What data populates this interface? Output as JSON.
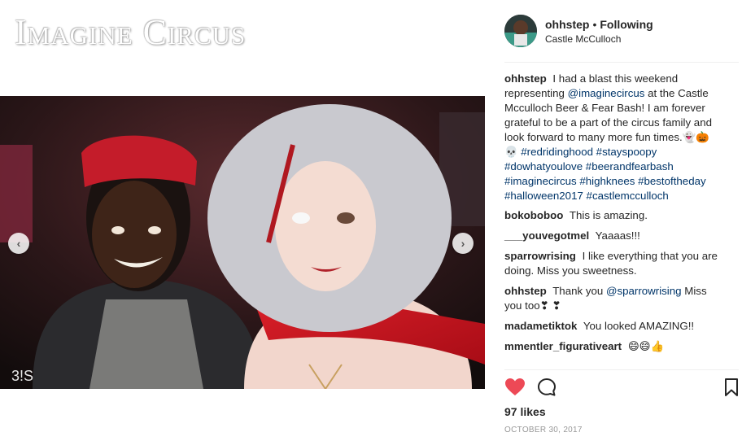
{
  "logo": {
    "text": "Imagine Circus"
  },
  "photo": {
    "watermark": "3ǃS",
    "prev_glyph": "‹",
    "next_glyph": "›"
  },
  "post": {
    "username": "ohhstep",
    "separator": "•",
    "follow_label": "Following",
    "location": "Castle McCulloch",
    "caption": {
      "user": "ohhstep",
      "text_before": "I had a blast this weekend representing",
      "mention": "@imaginecircus",
      "text_after": "at the Castle Mcculloch Beer & Fear Bash! I am forever grateful to be a part of the circus family and look forward to many more fun times.",
      "emoji": "👻🎃💀",
      "hashtags": "#redridinghood #stayspoopy #dowhatyoulove #beerandfearbash #imaginecircus #highknees #bestoftheday #halloween2017 #castlemcculloch"
    },
    "comments": [
      {
        "user": "bokoboboo",
        "text": "This is amazing."
      },
      {
        "user": "___youvegotmel",
        "text": "Yaaaas!!!"
      },
      {
        "user": "sparrowrising",
        "text": "I like everything that you are doing. Miss you sweetness."
      },
      {
        "user": "ohhstep",
        "text_before": "Thank you",
        "mention": "@sparrowrising",
        "text_after": "Miss you too❣ ❣"
      },
      {
        "user": "madametiktok",
        "text": "You looked AMAZING!!"
      },
      {
        "user": "mmentler_figurativeart",
        "text": "😄😄👍"
      }
    ],
    "likes": "97 likes",
    "date": "OCTOBER 30, 2017"
  },
  "icons": {
    "like": "heart-icon",
    "comment": "comment-icon",
    "save": "bookmark-icon",
    "avatar": "avatar"
  },
  "colors": {
    "like_red": "#ed4956",
    "link_blue": "#003569",
    "text": "#262626",
    "muted": "#999999"
  }
}
